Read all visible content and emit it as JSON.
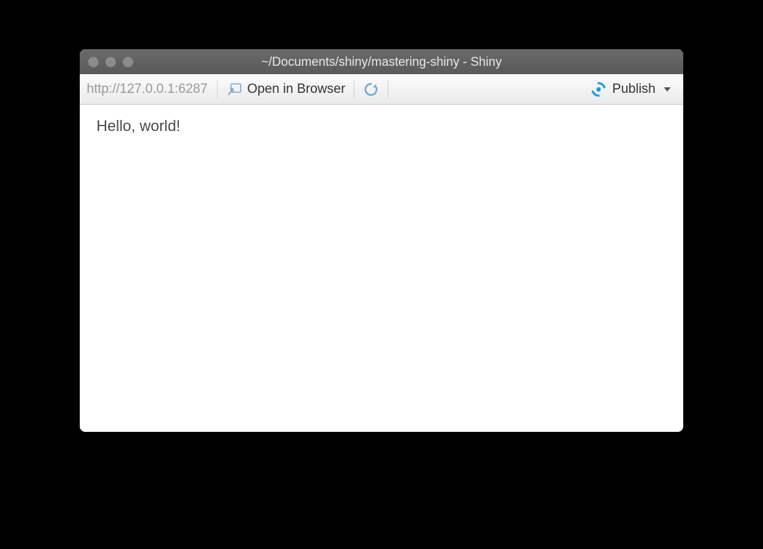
{
  "window": {
    "title": "~/Documents/shiny/mastering-shiny - Shiny"
  },
  "toolbar": {
    "url": "http://127.0.0.1:6287",
    "open_in_browser_label": "Open in Browser",
    "publish_label": "Publish"
  },
  "content": {
    "body_text": "Hello, world!"
  },
  "colors": {
    "accent_blue": "#1a9de0",
    "refresh_blue": "#6ea8cf"
  }
}
